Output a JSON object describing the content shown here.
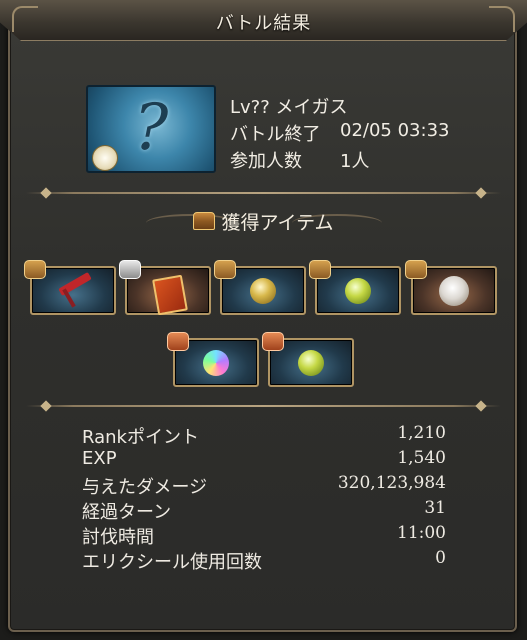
{
  "header": {
    "title": "バトル結果"
  },
  "enemy": {
    "name": "Lv?? メイガス",
    "battle_end_label": "バトル終了",
    "battle_end_value": "02/05 03:33",
    "participants_label": "参加人数",
    "participants_value": "1人"
  },
  "items_section": {
    "title": "獲得アイテム"
  },
  "items": [
    {
      "name": "item-hammer"
    },
    {
      "name": "item-red-book"
    },
    {
      "name": "item-gold-orb"
    },
    {
      "name": "item-green-orb"
    },
    {
      "name": "item-white-orb"
    },
    {
      "name": "item-rainbow-orb"
    },
    {
      "name": "item-green-orb-2"
    }
  ],
  "stats": [
    {
      "label": "Rankポイント",
      "value": "1,210"
    },
    {
      "label": "EXP",
      "value": "1,540"
    },
    {
      "label": "与えたダメージ",
      "value": "320,123,984"
    },
    {
      "label": "経過ターン",
      "value": "31"
    },
    {
      "label": "討伐時間",
      "value": "11:00"
    },
    {
      "label": "エリクシール使用回数",
      "value": "0"
    }
  ]
}
